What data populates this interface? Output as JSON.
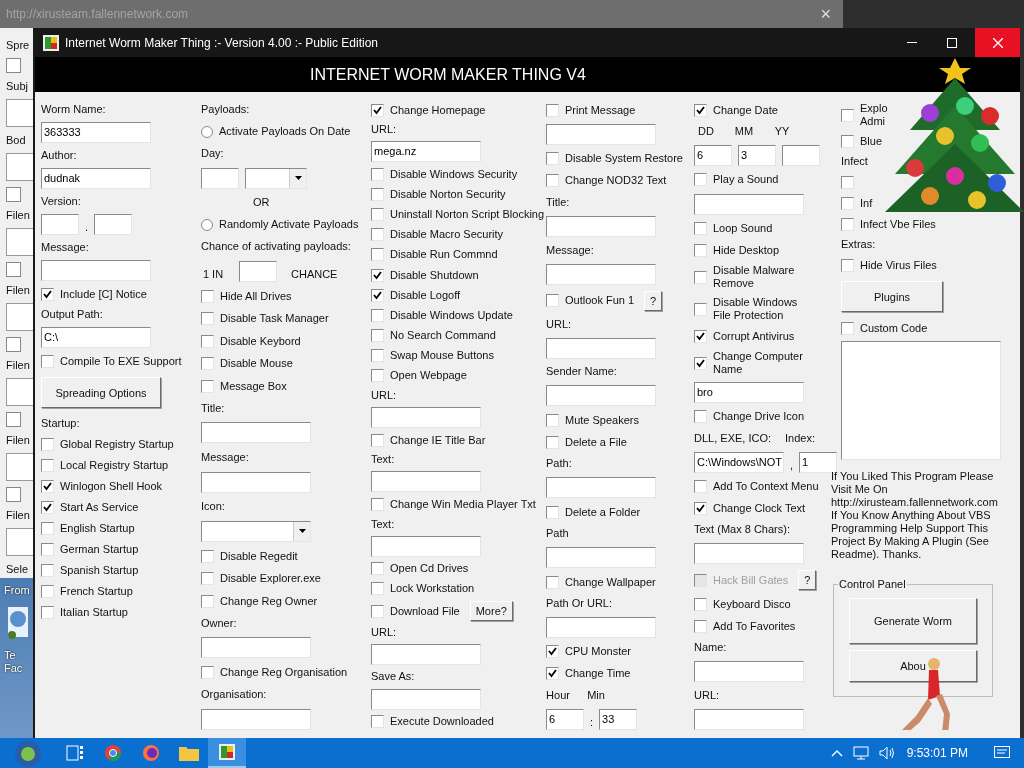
{
  "backdrop": {
    "url": "http://xirusteam.fallennetwork.com",
    "close": "×",
    "side_items": [
      {
        "kind": "label",
        "text": "Spre"
      },
      {
        "kind": "check",
        "checked": false
      },
      {
        "kind": "label",
        "text": "Subj"
      },
      {
        "kind": "field"
      },
      {
        "kind": "label",
        "text": "Bod"
      },
      {
        "kind": "field"
      },
      {
        "kind": "check",
        "checked": false
      },
      {
        "kind": "label",
        "text": "Filen"
      },
      {
        "kind": "field"
      },
      {
        "kind": "check",
        "checked": false
      },
      {
        "kind": "label",
        "text": "Filen"
      },
      {
        "kind": "field"
      },
      {
        "kind": "check",
        "checked": false
      },
      {
        "kind": "label",
        "text": "Filen"
      },
      {
        "kind": "field"
      },
      {
        "kind": "check",
        "checked": false
      },
      {
        "kind": "label",
        "text": "Filen"
      },
      {
        "kind": "field"
      },
      {
        "kind": "check",
        "checked": false
      },
      {
        "kind": "label",
        "text": "Filen"
      },
      {
        "kind": "field"
      },
      {
        "kind": "label",
        "text": "Sele"
      }
    ],
    "desktop_label": "From",
    "desktop_icon_label": "Te\nFac"
  },
  "window": {
    "title": "Internet Worm Maker Thing :- Version 4.00 :- Public Edition",
    "heading": "INTERNET WORM MAKER THING V4"
  },
  "columns": [
    {
      "items": [
        {
          "kind": "label",
          "text": "Worm Name:"
        },
        {
          "kind": "field",
          "value": "363333"
        },
        {
          "kind": "label",
          "text": "Author:"
        },
        {
          "kind": "field",
          "value": "dudnak"
        },
        {
          "kind": "label",
          "text": "Version:"
        },
        {
          "kind": "row",
          "items": [
            {
              "kind": "field"
            },
            {
              "kind": "sep",
              "text": "."
            },
            {
              "kind": "field"
            }
          ]
        },
        {
          "kind": "label",
          "text": "Message:"
        },
        {
          "kind": "field"
        },
        {
          "kind": "check",
          "label": "Include [C] Notice",
          "checked": true
        },
        {
          "kind": "label",
          "text": "Output Path:"
        },
        {
          "kind": "field",
          "value": "C:\\"
        },
        {
          "kind": "check",
          "label": "Compile To EXE Support",
          "checked": false
        },
        {
          "kind": "button",
          "label": "Spreading Options"
        },
        {
          "kind": "label",
          "text": "Startup:"
        },
        {
          "kind": "check",
          "label": "Global Registry Startup",
          "checked": false
        },
        {
          "kind": "check",
          "label": "Local Registry Startup",
          "checked": false
        },
        {
          "kind": "check",
          "label": "Winlogon Shell Hook",
          "checked": true
        },
        {
          "kind": "check",
          "label": "Start As Service",
          "checked": true
        },
        {
          "kind": "check",
          "label": "English Startup",
          "checked": false
        },
        {
          "kind": "check",
          "label": "German Startup",
          "checked": false
        },
        {
          "kind": "check",
          "label": "Spanish Startup",
          "checked": false
        },
        {
          "kind": "check",
          "label": "French Startup",
          "checked": false
        },
        {
          "kind": "check",
          "label": "Italian Startup",
          "checked": false
        }
      ]
    },
    {
      "items": [
        {
          "kind": "label",
          "text": "Payloads:"
        },
        {
          "kind": "radio",
          "label": "Activate Payloads On Date",
          "selected": false
        },
        {
          "kind": "label",
          "text": "Day:"
        },
        {
          "kind": "row",
          "items": [
            {
              "kind": "field"
            },
            {
              "kind": "combo"
            }
          ]
        },
        {
          "kind": "caption",
          "text": "OR"
        },
        {
          "kind": "radio",
          "label": "Randomly Activate Payloads",
          "selected": false
        },
        {
          "kind": "label",
          "text": "Chance of activating payloads:"
        },
        {
          "kind": "row",
          "items": [
            {
              "kind": "text",
              "text": "1 IN"
            },
            {
              "kind": "field"
            },
            {
              "kind": "text",
              "text": "CHANCE"
            }
          ]
        },
        {
          "kind": "check",
          "label": "Hide All Drives",
          "checked": false
        },
        {
          "kind": "check",
          "label": "Disable Task Manager",
          "checked": false
        },
        {
          "kind": "check",
          "label": "Disable Keybord",
          "checked": false
        },
        {
          "kind": "check",
          "label": "Disable Mouse",
          "checked": false
        },
        {
          "kind": "check",
          "label": "Message Box",
          "checked": false
        },
        {
          "kind": "label",
          "text": "Title:"
        },
        {
          "kind": "field"
        },
        {
          "kind": "label",
          "text": "Message:"
        },
        {
          "kind": "field"
        },
        {
          "kind": "label",
          "text": "Icon:"
        },
        {
          "kind": "combo"
        },
        {
          "kind": "check",
          "label": "Disable Regedit",
          "checked": false
        },
        {
          "kind": "check",
          "label": "Disable Explorer.exe",
          "checked": false
        },
        {
          "kind": "check",
          "label": "Change Reg Owner",
          "checked": false
        },
        {
          "kind": "label",
          "text": "Owner:"
        },
        {
          "kind": "field"
        },
        {
          "kind": "check",
          "label": "Change Reg Organisation",
          "checked": false
        },
        {
          "kind": "label",
          "text": "Organisation:"
        },
        {
          "kind": "field"
        }
      ]
    },
    {
      "items": [
        {
          "kind": "check",
          "label": "Change Homepage",
          "checked": true
        },
        {
          "kind": "label",
          "text": "URL:"
        },
        {
          "kind": "field",
          "value": "mega.nz"
        },
        {
          "kind": "check",
          "label": "Disable Windows Security",
          "checked": false
        },
        {
          "kind": "check",
          "label": "Disable Norton Security",
          "checked": false
        },
        {
          "kind": "check",
          "label": "Uninstall Norton Script Blocking",
          "checked": false
        },
        {
          "kind": "check",
          "label": "Disable Macro Security",
          "checked": false
        },
        {
          "kind": "check",
          "label": "Disable Run Commnd",
          "checked": false
        },
        {
          "kind": "check",
          "label": "Disable Shutdown",
          "checked": true
        },
        {
          "kind": "check",
          "label": "Disable Logoff",
          "checked": true
        },
        {
          "kind": "check",
          "label": "Disable Windows Update",
          "checked": false
        },
        {
          "kind": "check",
          "label": "No Search Command",
          "checked": false
        },
        {
          "kind": "check",
          "label": "Swap Mouse Buttons",
          "checked": false
        },
        {
          "kind": "check",
          "label": "Open Webpage",
          "checked": false
        },
        {
          "kind": "label",
          "text": "URL:"
        },
        {
          "kind": "field"
        },
        {
          "kind": "check",
          "label": "Change IE Title Bar",
          "checked": false
        },
        {
          "kind": "label",
          "text": "Text:"
        },
        {
          "kind": "field"
        },
        {
          "kind": "check",
          "label": "Change Win Media Player Txt",
          "checked": false
        },
        {
          "kind": "label",
          "text": "Text:"
        },
        {
          "kind": "field"
        },
        {
          "kind": "check",
          "label": "Open Cd Drives",
          "checked": false
        },
        {
          "kind": "check",
          "label": "Lock Workstation",
          "checked": false
        },
        {
          "kind": "check",
          "label": "Download File",
          "checked": false,
          "button": "More?"
        },
        {
          "kind": "label",
          "text": "URL:"
        },
        {
          "kind": "field"
        },
        {
          "kind": "label",
          "text": "Save As:"
        },
        {
          "kind": "field"
        },
        {
          "kind": "check",
          "label": "Execute Downloaded",
          "checked": false
        }
      ]
    },
    {
      "items": [
        {
          "kind": "check",
          "label": "Print Message",
          "checked": false
        },
        {
          "kind": "field"
        },
        {
          "kind": "check",
          "label": "Disable System Restore",
          "checked": false
        },
        {
          "kind": "check",
          "label": "Change NOD32 Text",
          "checked": false
        },
        {
          "kind": "label",
          "text": "Title:"
        },
        {
          "kind": "field"
        },
        {
          "kind": "label",
          "text": "Message:"
        },
        {
          "kind": "field"
        },
        {
          "kind": "check",
          "label": "Outlook Fun 1",
          "checked": false,
          "button": "?"
        },
        {
          "kind": "label",
          "text": "URL:"
        },
        {
          "kind": "field"
        },
        {
          "kind": "label",
          "text": "Sender Name:"
        },
        {
          "kind": "field"
        },
        {
          "kind": "check",
          "label": "Mute Speakers",
          "checked": false
        },
        {
          "kind": "check",
          "label": "Delete a File",
          "checked": false
        },
        {
          "kind": "label",
          "text": "Path:"
        },
        {
          "kind": "field"
        },
        {
          "kind": "check",
          "label": "Delete a Folder",
          "checked": false
        },
        {
          "kind": "label",
          "text": "Path"
        },
        {
          "kind": "field"
        },
        {
          "kind": "check",
          "label": "Change Wallpaper",
          "checked": false
        },
        {
          "kind": "label",
          "text": "Path Or URL:"
        },
        {
          "kind": "field"
        },
        {
          "kind": "check",
          "label": "CPU Monster",
          "checked": true
        },
        {
          "kind": "check",
          "label": "Change Time",
          "checked": true
        },
        {
          "kind": "row",
          "items": [
            {
              "kind": "text",
              "text": "Hour"
            },
            {
              "kind": "text",
              "text": "Min"
            }
          ]
        },
        {
          "kind": "row",
          "items": [
            {
              "kind": "field",
              "value": "6"
            },
            {
              "kind": "sep",
              "text": ":"
            },
            {
              "kind": "field",
              "value": "33"
            }
          ]
        }
      ]
    },
    {
      "items": [
        {
          "kind": "check",
          "label": "Change Date",
          "checked": true
        },
        {
          "kind": "row",
          "items": [
            {
              "kind": "text",
              "text": "DD"
            },
            {
              "kind": "text",
              "text": "MM"
            },
            {
              "kind": "text",
              "text": "YY"
            }
          ]
        },
        {
          "kind": "row",
          "items": [
            {
              "kind": "field",
              "value": "6"
            },
            {
              "kind": "field",
              "value": "3"
            },
            {
              "kind": "field"
            }
          ]
        },
        {
          "kind": "check",
          "label": "Play a Sound",
          "checked": false
        },
        {
          "kind": "field"
        },
        {
          "kind": "check",
          "label": "Loop Sound",
          "checked": false
        },
        {
          "kind": "check",
          "label": "Hide Desktop",
          "checked": false
        },
        {
          "kind": "check",
          "label": "Disable Malware\nRemove",
          "checked": false
        },
        {
          "kind": "check",
          "label": "Disable Windows\nFile Protection",
          "checked": false
        },
        {
          "kind": "check",
          "label": "Corrupt Antivirus",
          "checked": true
        },
        {
          "kind": "check",
          "label": "Change Computer\nName",
          "checked": true
        },
        {
          "kind": "field",
          "value": "bro"
        },
        {
          "kind": "check",
          "label": "Change Drive Icon",
          "checked": false
        },
        {
          "kind": "row",
          "items": [
            {
              "kind": "text",
              "text": "DLL, EXE, ICO:"
            },
            {
              "kind": "text",
              "text": "Index:"
            }
          ]
        },
        {
          "kind": "row",
          "items": [
            {
              "kind": "field",
              "value": "C:\\Windows\\NOT"
            },
            {
              "kind": "sep",
              "text": ","
            },
            {
              "kind": "field",
              "value": "1"
            }
          ]
        },
        {
          "kind": "check",
          "label": "Add To Context Menu",
          "checked": false
        },
        {
          "kind": "check",
          "label": "Change Clock Text",
          "checked": true
        },
        {
          "kind": "label",
          "text": "Text (Max 8 Chars):"
        },
        {
          "kind": "field"
        },
        {
          "kind": "check",
          "label": "Hack Bill Gates",
          "checked": false,
          "disabled": true,
          "button": "?"
        },
        {
          "kind": "check",
          "label": "Keyboard Disco",
          "checked": false
        },
        {
          "kind": "check",
          "label": "Add To Favorites",
          "checked": false
        },
        {
          "kind": "label",
          "text": "Name:"
        },
        {
          "kind": "field"
        },
        {
          "kind": "label",
          "text": "URL:"
        },
        {
          "kind": "field"
        }
      ]
    },
    {
      "items": [
        {
          "kind": "check",
          "label": "Explo\nAdmi",
          "checked": false
        },
        {
          "kind": "check",
          "label": "Blue",
          "checked": false
        },
        {
          "kind": "label",
          "text": "Infect"
        },
        {
          "kind": "check",
          "checked": false
        },
        {
          "kind": "check",
          "label": "Inf",
          "checked": false
        },
        {
          "kind": "check",
          "label": "Infect Vbe Files",
          "checked": false
        },
        {
          "kind": "label",
          "text": "Extras:"
        },
        {
          "kind": "check",
          "label": "Hide Virus Files",
          "checked": false
        },
        {
          "kind": "button",
          "label": "Plugins"
        },
        {
          "kind": "check",
          "label": "Custom Code",
          "checked": false
        },
        {
          "kind": "textarea"
        },
        {
          "kind": "paragraph",
          "text": "If You Liked This Program Please Visit Me On\nhttp://xirusteam.fallennetwork.com\nIf You Know Anything About VBS Programming Help Support This Project By Making A Plugin (See Readme). Thanks."
        },
        {
          "kind": "group",
          "title": "Control Panel",
          "buttons": [
            "Generate Worm",
            "Abou"
          ]
        }
      ]
    }
  ],
  "taskbar": {
    "clock": "9:53:01 PM"
  }
}
